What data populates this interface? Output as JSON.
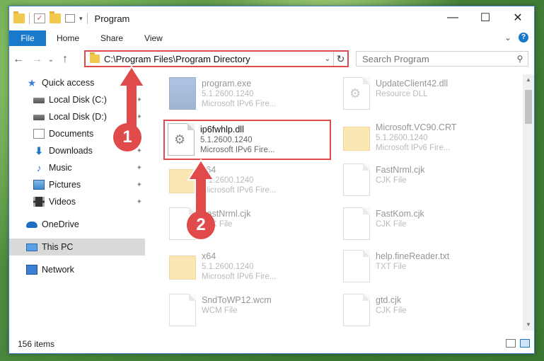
{
  "window": {
    "title": "Program",
    "minimize_glyph": "—",
    "maximize_glyph": "☐",
    "close_glyph": "✕"
  },
  "ribbon": {
    "tabs": [
      "File",
      "Home",
      "Share",
      "View"
    ],
    "collapse_glyph": "⌄",
    "help_glyph": "?"
  },
  "nav": {
    "back_glyph": "←",
    "forward_glyph": "→",
    "recent_glyph": "⌄",
    "up_glyph": "↑",
    "address_path": "C:\\Program Files\\Program Directory",
    "address_dropdown_glyph": "⌄",
    "refresh_glyph": "↻",
    "search_placeholder": "Search Program",
    "search_glyph": "⚲"
  },
  "sidebar": {
    "items": [
      {
        "label": "Quick access",
        "icon": "star-icon",
        "pinned": false
      },
      {
        "label": "Local Disk (C:)",
        "icon": "disk-icon",
        "pinned": true
      },
      {
        "label": "Local Disk (D:)",
        "icon": "disk-icon",
        "pinned": true
      },
      {
        "label": "Documents",
        "icon": "documents-icon",
        "pinned": true
      },
      {
        "label": "Downloads",
        "icon": "download-icon",
        "pinned": true
      },
      {
        "label": "Music",
        "icon": "music-icon",
        "pinned": true
      },
      {
        "label": "Pictures",
        "icon": "pictures-icon",
        "pinned": true
      },
      {
        "label": "Videos",
        "icon": "videos-icon",
        "pinned": true
      },
      {
        "label": "OneDrive",
        "icon": "onedrive-icon",
        "pinned": false
      },
      {
        "label": "This PC",
        "icon": "pc-icon",
        "pinned": false,
        "selected": true
      },
      {
        "label": "Network",
        "icon": "network-icon",
        "pinned": false
      }
    ]
  },
  "files": [
    {
      "name": "program.exe",
      "line2": "5.1.2600.1240",
      "line3": "Microsoft IPv6 Fire...",
      "type": "exe",
      "faded": true
    },
    {
      "name": "UpdateClient42.dll",
      "line2": "Resource DLL",
      "line3": "",
      "type": "dll",
      "faded": true
    },
    {
      "name": "ip6fwhlp.dll",
      "line2": "5.1.2600.1240",
      "line3": "Microsoft IPv6 Fire...",
      "type": "dll",
      "faded": false
    },
    {
      "name": "Microsoft.VC90.CRT",
      "line2": "5.1.2600.1240",
      "line3": "Microsoft IPv6 Fire...",
      "type": "folder",
      "faded": true
    },
    {
      "name": "x64",
      "line2": "5.1.2600.1240",
      "line3": "Microsoft IPv6 Fire...",
      "type": "folder",
      "faded": true
    },
    {
      "name": "FastNrml.cjk",
      "line2": "CJK File",
      "line3": "",
      "type": "doc",
      "faded": true
    },
    {
      "name": "FastNrml.cjk",
      "line2": "CJK File",
      "line3": "",
      "type": "doc",
      "faded": true
    },
    {
      "name": "FastKom.cjk",
      "line2": "CJK File",
      "line3": "",
      "type": "doc",
      "faded": true
    },
    {
      "name": "x64",
      "line2": "5.1.2600.1240",
      "line3": "Microsoft IPv6 Fire...",
      "type": "folder",
      "faded": true
    },
    {
      "name": "help.fineReader.txt",
      "line2": "TXT File",
      "line3": "",
      "type": "doc",
      "faded": true
    },
    {
      "name": "SndToWP12.wcm",
      "line2": "WCM File",
      "line3": "",
      "type": "doc",
      "faded": true
    },
    {
      "name": "gtd.cjk",
      "line2": "CJK File",
      "line3": "",
      "type": "doc",
      "faded": true
    }
  ],
  "status": {
    "item_count": "156 items"
  },
  "annotations": {
    "step1": "1",
    "step2": "2",
    "color": "#e04a4a"
  },
  "colors": {
    "accent": "#1979ca",
    "highlight_border": "#e04a4a"
  }
}
